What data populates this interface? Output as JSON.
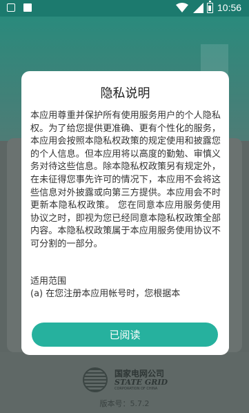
{
  "status_bar": {
    "time": "10:56",
    "icons": [
      "app-notification-icon",
      "image-notification-icon",
      "wifi-icon",
      "cellular-signal-icon",
      "battery-icon"
    ]
  },
  "background_app": {
    "logo_cn": "国家电网公司",
    "logo_en": "STATE GRID",
    "logo_en_sub": "CORPORATION OF CHINA",
    "version": "版本号：5.7.2"
  },
  "dialog": {
    "title": "隐私说明",
    "body": "本应用尊重并保护所有使用服务用户的个人隐私权。为了给您提供更准确、更有个性化的服务，本应用会按照本隐私权政策的规定使用和披露您的个人信息。但本应用将以高度的勤勉、审慎义务对待这些信息。除本隐私权政策另有规定外，在未征得您事先许可的情况下，本应用不会将这些信息对外披露或向第三方提供。本应用会不时更新本隐私权政策。 您在同意本应用服务使用协议之时，即视为您已经同意本隐私权政策全部内容。本隐私权政策属于本应用服务使用协议不可分割的一部分。",
    "section_title": "适用范围",
    "section_item": "(a) 在您注册本应用帐号时，您根据本",
    "confirm_label": "已阅读"
  },
  "colors": {
    "accent": "#26b19e",
    "status_bar": "#1c7a6e",
    "overlay": "#5d6664"
  }
}
